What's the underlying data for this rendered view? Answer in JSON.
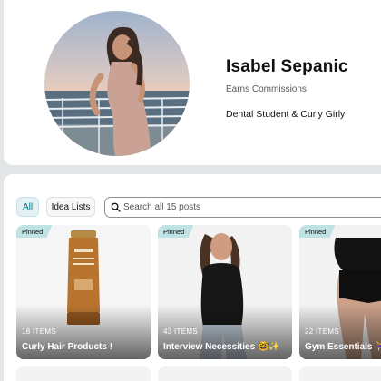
{
  "profile": {
    "name": "Isabel Sepanic",
    "earns": "Earns Commissions",
    "bio": "Dental Student & Curly Girly"
  },
  "filters": {
    "all": "All",
    "idea_lists": "Idea Lists"
  },
  "search": {
    "placeholder": "Search all 15 posts"
  },
  "posts": [
    {
      "tag": "Pinned",
      "count": "18 ITEMS",
      "title": "Curly Hair Products !"
    },
    {
      "tag": "Pinned",
      "count": "43 ITEMS",
      "title": "Interview Necessities 🤓✨"
    },
    {
      "tag": "Pinned",
      "count": "22 ITEMS",
      "title": "Gym Essentials 🏋️‍♀️"
    }
  ],
  "colors": {
    "accent": "#007185",
    "pinned_tag": "#bfe2e4"
  }
}
